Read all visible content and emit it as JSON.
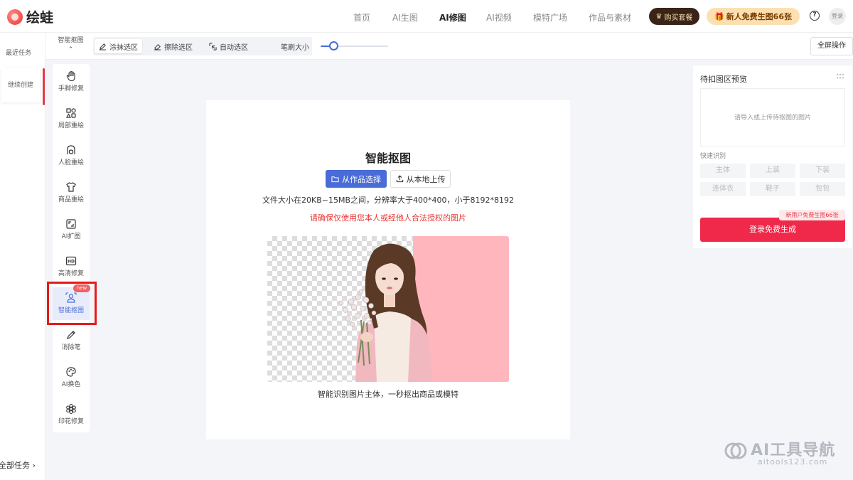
{
  "app": {
    "name": "绘蛙"
  },
  "nav": {
    "items": [
      {
        "label": "首页",
        "active": false
      },
      {
        "label": "AI生图",
        "active": false
      },
      {
        "label": "AI修图",
        "active": true
      },
      {
        "label": "AI视频",
        "active": false
      },
      {
        "label": "模特广场",
        "active": false
      },
      {
        "label": "作品与素材",
        "active": false
      }
    ],
    "buy_label": "购买套餐",
    "free_label": "新人免费生图66张",
    "help_icon": "?",
    "login_label": "登录"
  },
  "history": {
    "recent_label": "最近任务",
    "continue_label": "继续创建",
    "all_tasks_label": "全部任务",
    "all_tasks_arrow": "›"
  },
  "toolbar": {
    "mode_label": "智能抠图",
    "mode_arrow": "⌃",
    "tools": [
      {
        "label": "涂抹选区",
        "icon": "pencil-icon",
        "active": true
      },
      {
        "label": "擦除选区",
        "icon": "eraser-icon",
        "active": false
      },
      {
        "label": "自动选区",
        "icon": "auto-select-icon",
        "active": false
      }
    ],
    "brush_label": "笔刷大小",
    "brush_size": 0.15,
    "fullscreen_label": "全屏操作"
  },
  "tools_panel": {
    "items": [
      {
        "label": "手脚修复",
        "icon": "hand-icon"
      },
      {
        "label": "局部重绘",
        "icon": "shapes-icon"
      },
      {
        "label": "人脸重绘",
        "icon": "face-icon"
      },
      {
        "label": "商品重绘",
        "icon": "shirt-icon"
      },
      {
        "label": "AI扩图",
        "icon": "expand-icon"
      },
      {
        "label": "高清修复",
        "icon": "hd-icon"
      },
      {
        "label": "智能抠图",
        "icon": "person-cutout-icon",
        "selected": true,
        "badge": "new"
      },
      {
        "label": "消除笔",
        "icon": "brush-icon"
      },
      {
        "label": "AI换色",
        "icon": "palette-icon"
      },
      {
        "label": "印花修复",
        "icon": "flower-icon"
      }
    ]
  },
  "canvas": {
    "title": "智能抠图",
    "btn_works": "从作品选择",
    "btn_local": "从本地上传",
    "file_info": "文件大小在20KB~15MB之间，分辨率大于400*400，小于8192*8192",
    "warning": "请确保仅使用您本人或经他人合法授权的图片",
    "caption": "智能识别图片主体，一秒抠出商品或模特"
  },
  "preview": {
    "title": "待扣图区预览",
    "upload_hint": "请导入或上传待抠图的图片",
    "quick_label": "快速识别",
    "chips": [
      "主体",
      "上装",
      "下装",
      "连体衣",
      "鞋子",
      "包包"
    ],
    "promo": "新用户免费生图66张",
    "login_button": "登录免费生成"
  },
  "watermark": {
    "main": "AI工具导航",
    "sub": "aitools123.com"
  },
  "colors": {
    "accent": "#4a6cd8",
    "brand_red": "#f0284a",
    "highlight": "#e51a1a"
  }
}
